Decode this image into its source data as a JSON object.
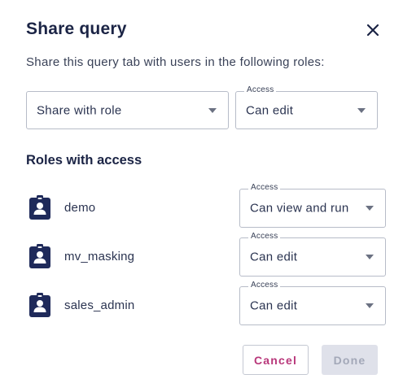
{
  "dialog": {
    "title": "Share query",
    "subtitle": "Share this query tab with users in the following roles:"
  },
  "share_form": {
    "role_select_value": "Share with role",
    "access_label": "Access",
    "access_value": "Can edit"
  },
  "roles_section": {
    "title": "Roles with access",
    "roles": [
      {
        "name": "demo",
        "access_label": "Access",
        "access": "Can view and run"
      },
      {
        "name": "mv_masking",
        "access_label": "Access",
        "access": "Can edit"
      },
      {
        "name": "sales_admin",
        "access_label": "Access",
        "access": "Can edit"
      }
    ]
  },
  "actions": {
    "cancel_label": "Cancel",
    "done_label": "Done"
  },
  "colors": {
    "title": "#1b2445",
    "icon": "#1f2a5a",
    "cancel_text": "#b8377a",
    "done_bg": "#dfe1ea"
  },
  "icons": {
    "close": "close-icon",
    "role": "badge-icon",
    "caret": "chevron-down-icon"
  }
}
